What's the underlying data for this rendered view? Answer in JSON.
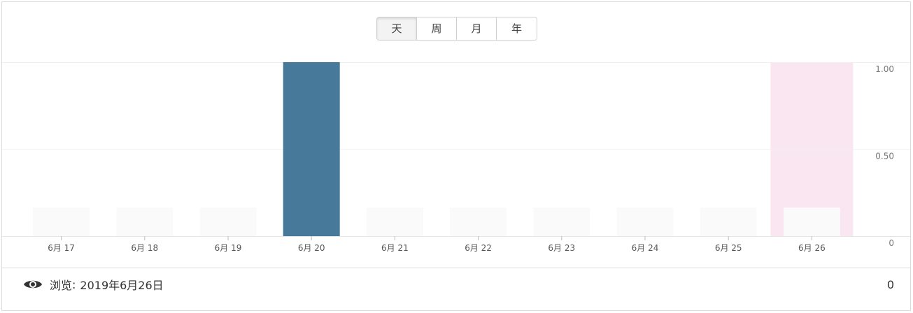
{
  "period_buttons": [
    {
      "label": "天",
      "active": true
    },
    {
      "label": "周",
      "active": false
    },
    {
      "label": "月",
      "active": false
    },
    {
      "label": "年",
      "active": false
    }
  ],
  "chart_data": {
    "type": "bar",
    "categories": [
      "6月 17",
      "6月 18",
      "6月 19",
      "6月 20",
      "6月 21",
      "6月 22",
      "6月 23",
      "6月 24",
      "6月 25",
      "6月 26"
    ],
    "values": [
      0,
      0,
      0,
      1,
      0,
      0,
      0,
      0,
      0,
      0
    ],
    "y_ticks": [
      "1.00",
      "0.50",
      "0"
    ],
    "ylim": [
      0,
      1
    ],
    "y_axis_position": "right",
    "grid": true,
    "highlighted_category": "6月 26",
    "colors": {
      "bar": "#47799a",
      "bar_placeholder": "#fafafa",
      "highlight": "#f9e6f0",
      "gridline": "#efefef"
    }
  },
  "footer": {
    "icon": "eye-icon",
    "label": "浏览",
    "separator": ":",
    "date": "2019年6月26日",
    "count": "0"
  }
}
